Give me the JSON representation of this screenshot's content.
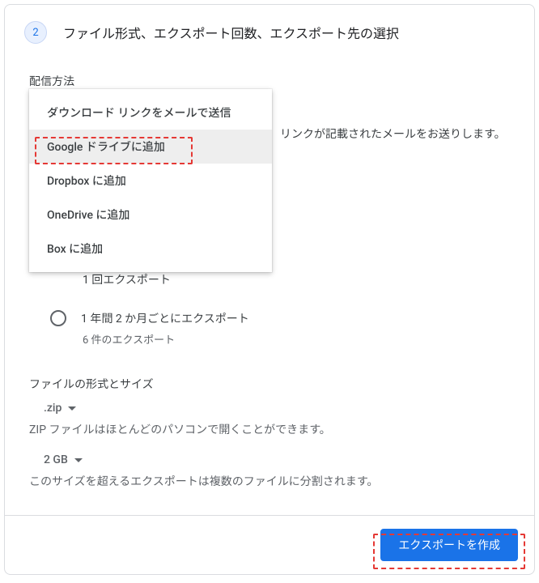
{
  "header": {
    "step_number": "2",
    "title": "ファイル形式、エクスポート回数、エクスポート先の選択"
  },
  "delivery": {
    "label": "配信方法",
    "hint_text": "リンクが記載されたメールをお送りします。",
    "menu": {
      "items": [
        {
          "label": "ダウンロード リンクをメールで送信"
        },
        {
          "label": "Google ドライブに追加"
        },
        {
          "label": "Dropbox に追加"
        },
        {
          "label": "OneDrive に追加"
        },
        {
          "label": "Box に追加"
        }
      ]
    }
  },
  "frequency": {
    "once_sub": "1 回エクスポート",
    "periodic_label": "1 年間 2 か月ごとにエクスポート",
    "periodic_sub": "6 件のエクスポート"
  },
  "file": {
    "section_label": "ファイルの形式とサイズ",
    "format_value": ".zip",
    "format_help": "ZIP ファイルはほとんどのパソコンで開くことができます。",
    "size_value": "2 GB",
    "size_help": "このサイズを超えるエクスポートは複数のファイルに分割されます。"
  },
  "footer": {
    "create_label": "エクスポートを作成"
  }
}
